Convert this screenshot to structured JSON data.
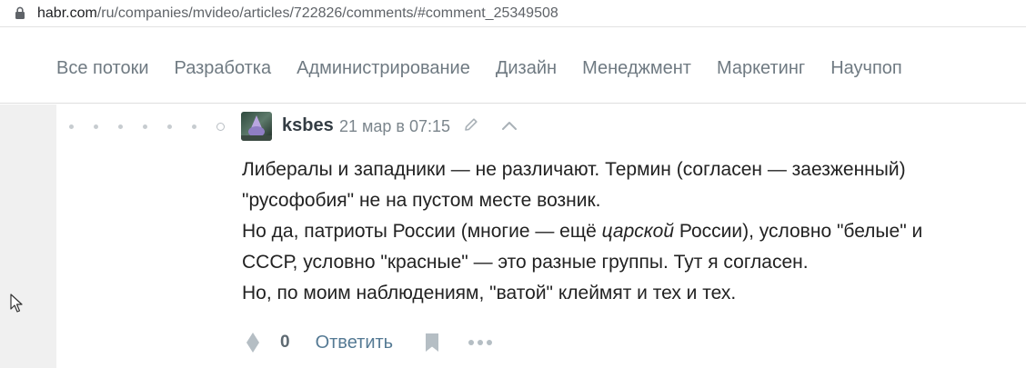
{
  "address_bar": {
    "host": "habr.com",
    "path": "/ru/companies/mvideo/articles/722826/comments/#comment_25349508"
  },
  "nav": {
    "items": [
      {
        "label": "Все потоки"
      },
      {
        "label": "Разработка"
      },
      {
        "label": "Администрирование"
      },
      {
        "label": "Дизайн"
      },
      {
        "label": "Менеджмент"
      },
      {
        "label": "Маркетинг"
      },
      {
        "label": "Научпоп"
      }
    ]
  },
  "comment": {
    "author": "ksbes",
    "date": "21 мар в 07:15",
    "paragraphs": [
      "Либералы и западники — не различают. Термин (согласен — заезженный)",
      "\"русофобия\" не на пустом месте возник.",
      "Но да, патриоты России (многие — ещё ",
      "царской",
      " России), условно \"белые\" и",
      "СССР, условно \"красные\" — это разные группы. Тут я согласен.",
      "Но, по моим наблюдениям, \"ватой\" клеймят и тех и тех."
    ],
    "score": "0",
    "reply_label": "Ответить"
  },
  "icons": {
    "lock": "lock-icon",
    "edit": "pencil-icon",
    "collapse": "chevron-up-icon",
    "vote": "vote-diamond-icon",
    "bookmark": "bookmark-icon",
    "more": "more-dots-icon",
    "cursor": "mouse-cursor-icon"
  },
  "colors": {
    "nav_text": "#6f7a82",
    "link": "#557a94",
    "gutter": "#f0f0f0"
  }
}
